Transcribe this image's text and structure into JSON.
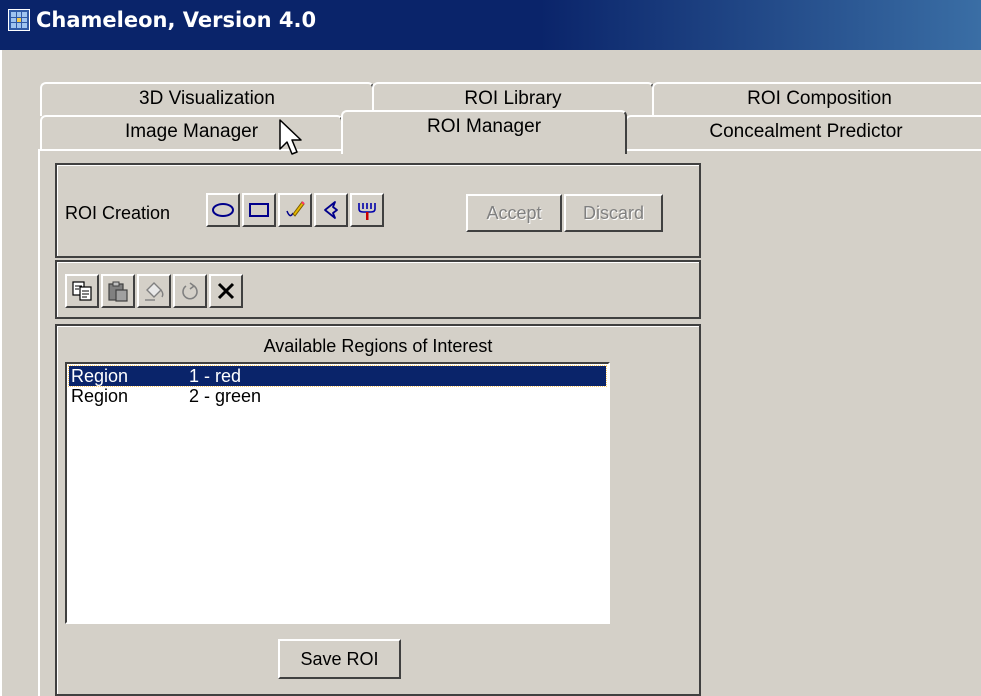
{
  "window": {
    "title": "Chameleon, Version 4.0"
  },
  "tabs": {
    "back_row": [
      "3D Visualization",
      "ROI Library",
      "ROI Composition"
    ],
    "front_row": [
      "Image Manager",
      "ROI Manager",
      "Concealment Predictor"
    ],
    "active": "ROI Manager"
  },
  "roi_creation": {
    "label": "ROI Creation",
    "tools": [
      "ellipse-icon",
      "rectangle-icon",
      "pencil-icon",
      "freeform-icon",
      "magic-wand-icon"
    ],
    "accept_label": "Accept",
    "discard_label": "Discard"
  },
  "edit_toolbar": {
    "tools": [
      "copy-icon",
      "paste-icon",
      "fill-icon",
      "undo-icon",
      "delete-icon"
    ]
  },
  "regions": {
    "heading": "Available Regions of Interest",
    "items": [
      {
        "name": "Region",
        "id": "1 - red",
        "selected": true
      },
      {
        "name": "Region",
        "id": "2 - green",
        "selected": false
      }
    ],
    "save_label": "Save ROI"
  }
}
